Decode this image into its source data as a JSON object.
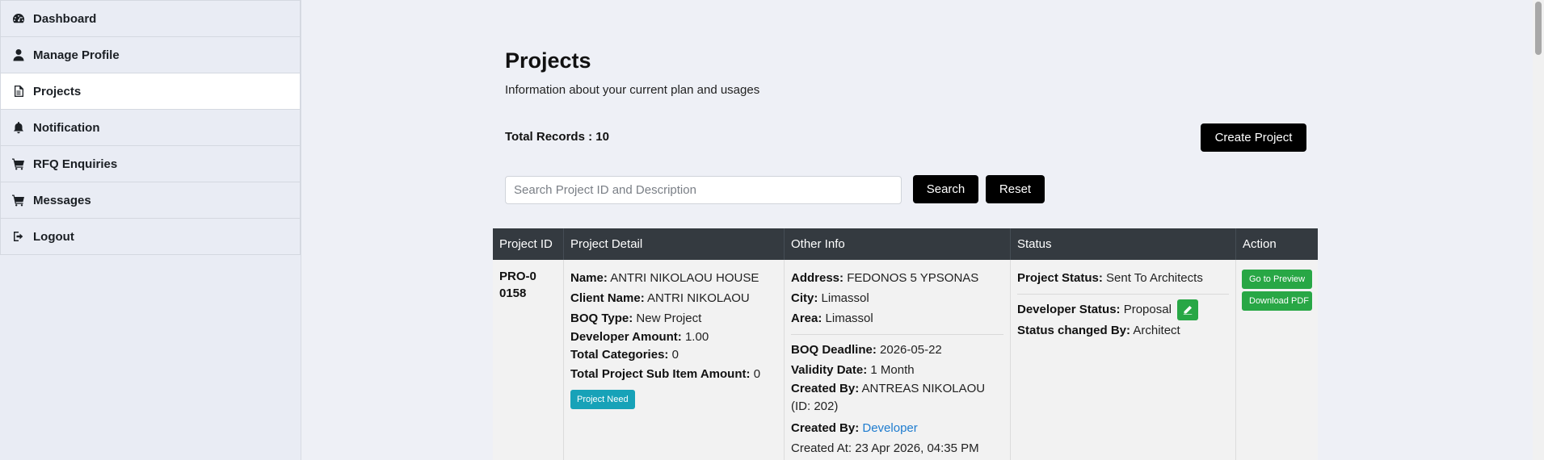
{
  "sidebar": {
    "items": [
      {
        "label": "Dashboard",
        "icon": "dashboard-icon"
      },
      {
        "label": "Manage Profile",
        "icon": "user-icon"
      },
      {
        "label": "Projects",
        "icon": "file-icon",
        "active": true
      },
      {
        "label": "Notification",
        "icon": "bell-icon"
      },
      {
        "label": "RFQ Enquiries",
        "icon": "cart-icon"
      },
      {
        "label": "Messages",
        "icon": "cart-icon"
      },
      {
        "label": "Logout",
        "icon": "logout-icon"
      }
    ]
  },
  "header": {
    "title": "Projects",
    "subtitle": "Information about your current plan and usages",
    "total_records": "Total Records : 10",
    "create_button": "Create Project"
  },
  "search": {
    "placeholder": "Search Project ID and Description",
    "value": "",
    "search_button": "Search",
    "reset_button": "Reset"
  },
  "table": {
    "headers": [
      "Project ID",
      "Project Detail",
      "Other Info",
      "Status",
      "Action"
    ],
    "row": {
      "project_id": "PRO-00158",
      "detail": {
        "name_label": "Name:",
        "name": "ANTRI NIKOLAOU HOUSE",
        "client_label": "Client Name:",
        "client": "ANTRI NIKOLAOU",
        "boq_type_label": "BOQ Type:",
        "boq_type": "New Project",
        "dev_amount_label": "Developer Amount:",
        "dev_amount": "1.00",
        "total_cat_label": "Total Categories:",
        "total_cat": "0",
        "sub_item_label": "Total Project Sub Item Amount:",
        "sub_item": "0",
        "need_button": "Project Need"
      },
      "other": {
        "address_label": "Address:",
        "address": "FEDONOS 5 YPSONAS",
        "city_label": "City:",
        "city": "Limassol",
        "area_label": "Area:",
        "area": "Limassol",
        "deadline_label": "BOQ Deadline:",
        "deadline": "2026-05-22",
        "validity_label": "Validity Date:",
        "validity": "1 Month",
        "created_by_label": "Created By:",
        "created_by": "ANTREAS NIKOLAOU (ID: 202)",
        "created_by2_label": "Created By:",
        "created_by2": "Developer",
        "created_at": "Created At: 23 Apr 2026, 04:35 PM"
      },
      "status": {
        "project_status_label": "Project Status:",
        "project_status": "Sent To Architects",
        "dev_status_label": "Developer Status:",
        "dev_status": "Proposal",
        "changed_by_label": "Status changed By:",
        "changed_by": "Architect"
      },
      "actions": {
        "preview": "Go to Preview",
        "download": "Download PDF"
      }
    }
  },
  "colors": {
    "accent_dark": "#000000",
    "table_header": "#343a40",
    "success": "#28a745",
    "info": "#17a2b8",
    "link": "#1e7ccf"
  }
}
